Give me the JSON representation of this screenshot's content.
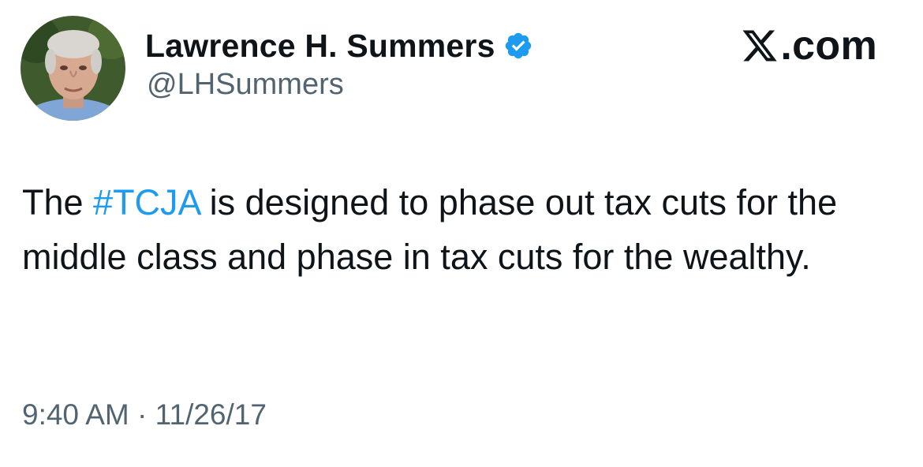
{
  "author": {
    "display_name": "Lawrence H. Summers",
    "handle": "@LHSummers",
    "verified_icon": "verified-badge-icon",
    "avatar_icon": "profile-photo-avatar"
  },
  "brand": {
    "logo_icon": "x-logo-icon",
    "suffix": ".com"
  },
  "tweet": {
    "text_before": "The ",
    "hashtag": "#TCJA",
    "text_after": " is designed to phase out tax cuts for the middle class and phase in tax cuts for the wealthy."
  },
  "meta": {
    "time": "9:40 AM",
    "separator": " · ",
    "date": "11/26/17"
  },
  "colors": {
    "text": "#0f1419",
    "secondary_text": "#536471",
    "link": "#1d9bf0",
    "verified": "#1d9bf0",
    "background": "#ffffff"
  }
}
